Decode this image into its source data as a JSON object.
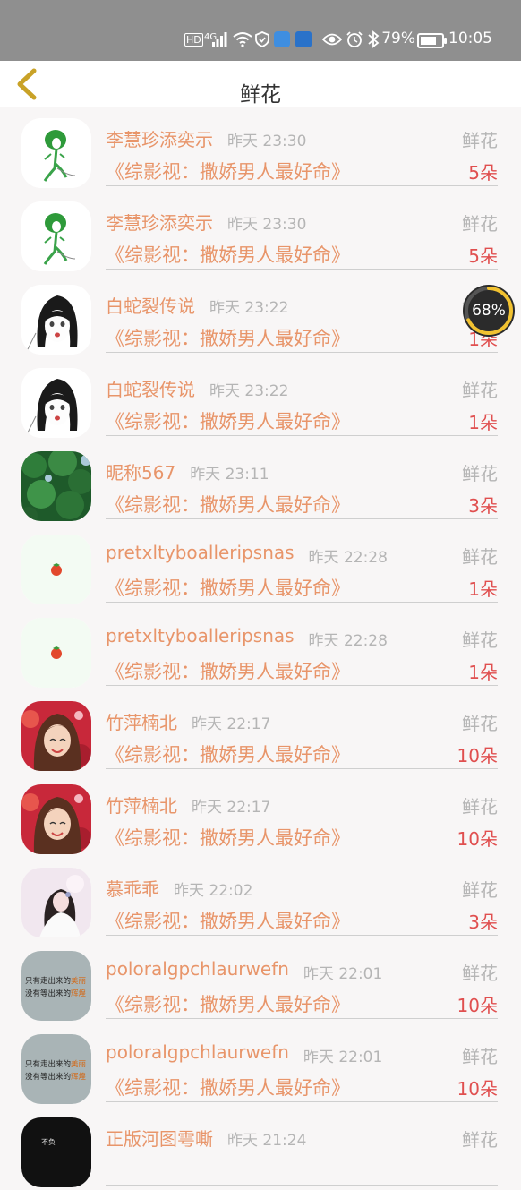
{
  "status_bar": {
    "icons": [
      "hd-icon",
      "4g-signal-icon",
      "wifi-icon",
      "shield-icon",
      "app-icon",
      "app-icon-2",
      "eye-icon",
      "alarm-icon",
      "bluetooth-icon"
    ],
    "hd": "HD",
    "net": "4G",
    "battery_percent": "79%",
    "battery_level": 0.79,
    "time": "10:05"
  },
  "header": {
    "title": "鲜花"
  },
  "floating_badge": {
    "value": "68%"
  },
  "rows": [
    {
      "name": "李慧珍添奕示",
      "time": "昨天 23:30",
      "label": "鲜花",
      "book": "《综影视：撒娇男人最好命》",
      "count": "5朵",
      "avatar": "green-figure"
    },
    {
      "name": "李慧珍添奕示",
      "time": "昨天 23:30",
      "label": "鲜花",
      "book": "《综影视：撒娇男人最好命》",
      "count": "5朵",
      "avatar": "green-figure"
    },
    {
      "name": "白蛇裂传说",
      "time": "昨天 23:22",
      "label": "鲜花",
      "book": "《综影视：撒娇男人最好命》",
      "count": "1朵",
      "avatar": "anime-girl"
    },
    {
      "name": "白蛇裂传说",
      "time": "昨天 23:22",
      "label": "鲜花",
      "book": "《综影视：撒娇男人最好命》",
      "count": "1朵",
      "avatar": "anime-girl"
    },
    {
      "name": "昵称567",
      "time": "昨天 23:11",
      "label": "鲜花",
      "book": "《综影视：撒娇男人最好命》",
      "count": "3朵",
      "avatar": "green-leaves"
    },
    {
      "name": "pretxltyboalleripsnas",
      "time": "昨天 22:28",
      "label": "鲜花",
      "book": "《综影视：撒娇男人最好命》",
      "count": "1朵",
      "avatar": "tomato"
    },
    {
      "name": "pretxltyboalleripsnas",
      "time": "昨天 22:28",
      "label": "鲜花",
      "book": "《综影视：撒娇男人最好命》",
      "count": "1朵",
      "avatar": "tomato"
    },
    {
      "name": "竹萍楠北",
      "time": "昨天 22:17",
      "label": "鲜花",
      "book": "《综影视：撒娇男人最好命》",
      "count": "10朵",
      "avatar": "red-girl"
    },
    {
      "name": "竹萍楠北",
      "time": "昨天 22:17",
      "label": "鲜花",
      "book": "《综影视：撒娇男人最好命》",
      "count": "10朵",
      "avatar": "red-girl"
    },
    {
      "name": "慕乖乖",
      "time": "昨天 22:02",
      "label": "鲜花",
      "book": "《综影视：撒娇男人最好命》",
      "count": "3朵",
      "avatar": "pink-girl"
    },
    {
      "name": "poloralgpchlaurwefn",
      "time": "昨天 22:01",
      "label": "鲜花",
      "book": "《综影视：撒娇男人最好命》",
      "count": "10朵",
      "avatar": "text-card"
    },
    {
      "name": "poloralgpchlaurwefn",
      "time": "昨天 22:01",
      "label": "鲜花",
      "book": "《综影视：撒娇男人最好命》",
      "count": "10朵",
      "avatar": "text-card"
    },
    {
      "name": "正版河图雩嘶",
      "time": "昨天 21:24",
      "label": "鲜花",
      "book": "",
      "count": "",
      "avatar": "black"
    }
  ],
  "avatar_text": {
    "line1a": "只有走出来的",
    "line1b": "美丽",
    "line2a": "没有等出来的",
    "line2b": "辉煌"
  },
  "colors": {
    "accent": "#e8956a",
    "count": "#e04f4f",
    "muted": "#b5b5b5",
    "status_bar": "#8f8f8f",
    "back_arrow": "#c9a227"
  }
}
